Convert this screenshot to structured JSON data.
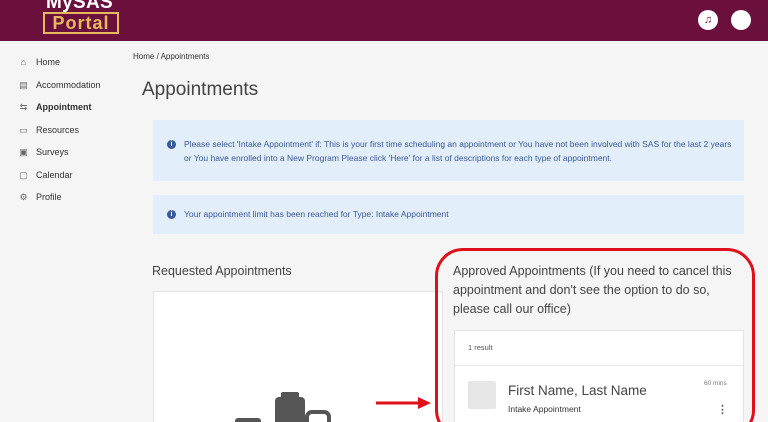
{
  "header": {
    "logo_top": "MySAS",
    "logo_bottom": "Portal",
    "music_icon": "♫",
    "brand_color": "#6b0f3d",
    "accent_color": "#e8b95c"
  },
  "sidebar": {
    "items": [
      {
        "label": "Home",
        "icon": "home-icon",
        "glyph": "⌂"
      },
      {
        "label": "Accommodation",
        "icon": "message-icon",
        "glyph": "▤"
      },
      {
        "label": "Appointment",
        "icon": "appointment-icon",
        "glyph": "⇆"
      },
      {
        "label": "Resources",
        "icon": "folder-icon",
        "glyph": "▭"
      },
      {
        "label": "Surveys",
        "icon": "survey-icon",
        "glyph": "▣"
      },
      {
        "label": "Calendar",
        "icon": "calendar-icon",
        "glyph": "▢"
      },
      {
        "label": "Profile",
        "icon": "gear-icon",
        "glyph": "⚙"
      }
    ],
    "active": "Appointment"
  },
  "breadcrumb": "Home  /  Appointments",
  "page_title": "Appointments",
  "alerts": [
    "Please select 'Intake Appointment' if: This is your first time scheduling an appointment or You have not been involved with SAS for the last 2 years or You have enrolled into a New Program Please click 'Here' for a list of descriptions for each type of appointment.",
    "Your appointment limit has been reached for Type: Intake Appointment"
  ],
  "alert_icon": "i",
  "requested": {
    "title": "Requested Appointments"
  },
  "approved": {
    "title": "Approved Appointments (If you need to cancel this appointment and don't see the option to do so, please call our office)",
    "result_count": "1 result",
    "appointment": {
      "name": "First Name, Last Name",
      "type": "Intake Appointment",
      "duration": "60 mins",
      "menu": "⋮"
    }
  },
  "annotation_color": "#e0101a"
}
